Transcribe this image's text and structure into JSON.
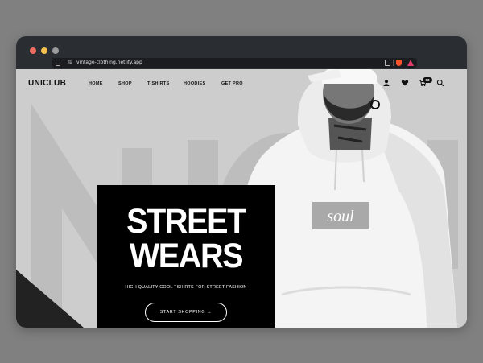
{
  "browser": {
    "url": "vintage-clothing.netlify.app"
  },
  "site": {
    "logo": "UNICLUB",
    "nav": [
      {
        "label": "HOME"
      },
      {
        "label": "SHOP"
      },
      {
        "label": "T-SHIRTS"
      },
      {
        "label": "HOODIES"
      },
      {
        "label": "GET PRO"
      }
    ],
    "icons": [
      "user-icon",
      "heart-icon",
      "cart-icon",
      "search-icon"
    ],
    "cart_count": "03",
    "background_word": "UNICLUB"
  },
  "hero": {
    "title_line1": "STREET",
    "title_line2": "WEARS",
    "subtitle": "HIGH QUALITY COOL TSHIRTS FOR STREET FASHION",
    "cta_label": "START SHOPPING →",
    "hoodie_print": "soul"
  },
  "colors": {
    "page_bg": "#cdcdcd",
    "card_bg": "#000000",
    "chrome": "#2a2d31",
    "text_dark": "#111111"
  }
}
